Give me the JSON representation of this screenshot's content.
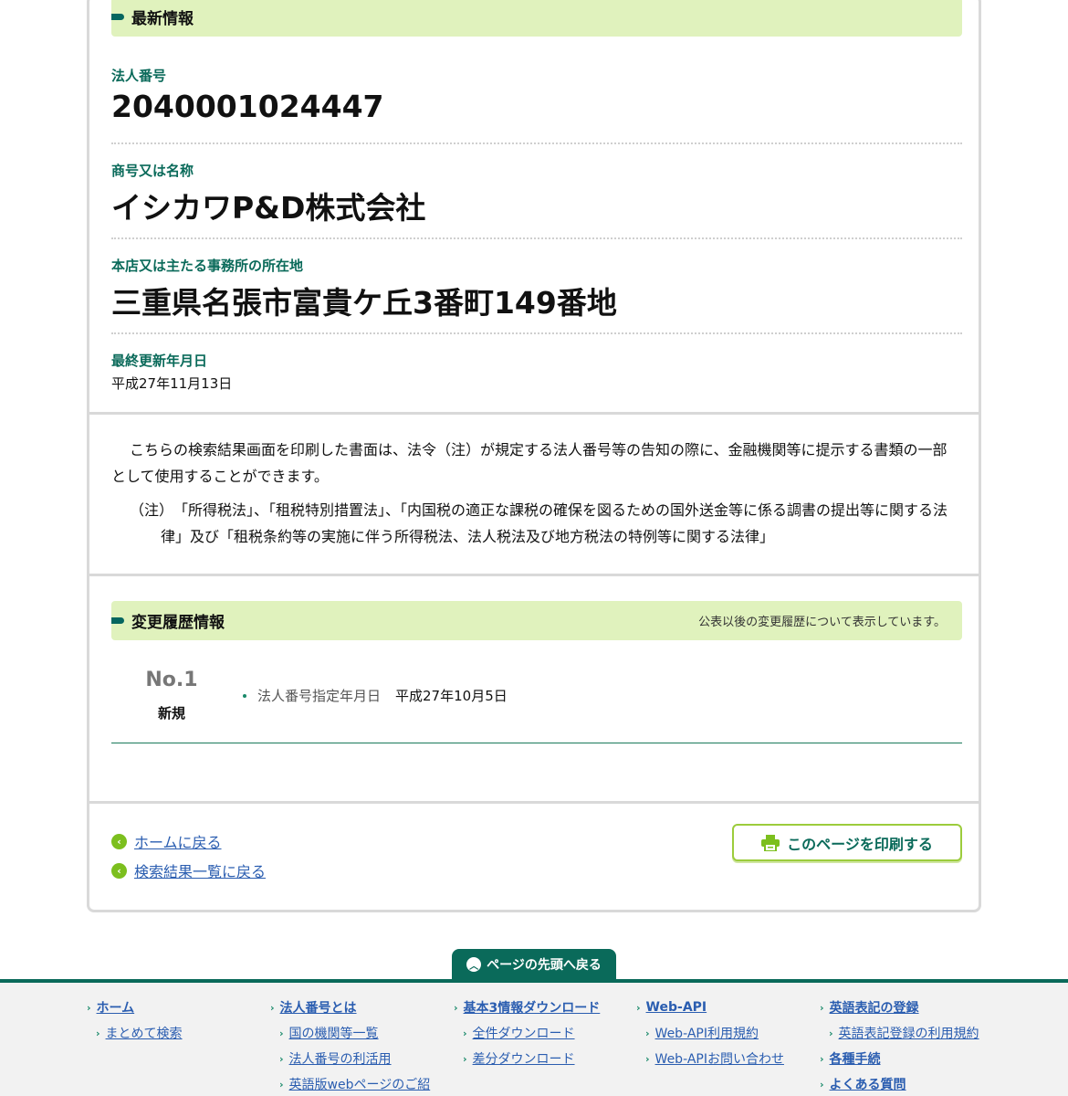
{
  "latest": {
    "heading": "最新情報",
    "corp_number_label": "法人番号",
    "corp_number": "2040001024447",
    "name_label": "商号又は名称",
    "name": "イシカワP&D株式会社",
    "address_label": "本店又は主たる事務所の所在地",
    "address": "三重県名張市富貴ケ丘3番町149番地",
    "updated_label": "最終更新年月日",
    "updated": "平成27年11月13日"
  },
  "notice": {
    "p1": "こちらの検索結果画面を印刷した書面は、法令（注）が規定する法人番号等の告知の際に、金融機関等に提示する書類の一部として使用することができます。",
    "p2": "（注）　「所得税法」、「租税特別措置法」、「内国税の適正な課税の確保を図るための国外送金等に係る調書の提出等に関する法律」及び「租税条約等の実施に伴う所得税法、法人税法及び地方税法の特例等に関する法律」"
  },
  "history": {
    "heading": "変更履歴情報",
    "note": "公表以後の変更履歴について表示しています。",
    "entries": [
      {
        "no": "No.1",
        "type": "新規",
        "item_key": "法人番号指定年月日",
        "item_value": "平成27年10月5日"
      }
    ]
  },
  "nav": {
    "home_link": "ホームに戻る",
    "results_link": "検索結果一覧に戻る",
    "print_button": "このページを印刷する",
    "to_top": "ページの先頭へ戻る"
  },
  "footer": {
    "col1": {
      "main": "ホーム",
      "subs": [
        "まとめて検索"
      ]
    },
    "col2": {
      "main": "法人番号とは",
      "subs": [
        "国の機関等一覧",
        "法人番号の利活用",
        "英語版webページのご紹"
      ]
    },
    "col3": {
      "main": "基本3情報ダウンロード",
      "subs": [
        "全件ダウンロード",
        "差分ダウンロード"
      ]
    },
    "col4": {
      "main": "Web-API",
      "subs": [
        "Web-API利用規約",
        "Web-APIお問い合わせ"
      ]
    },
    "col5": {
      "main": "英語表記の登録",
      "subs": [
        "英語表記登録の利用規約"
      ],
      "main2": "各種手続",
      "main3": "よくある質問"
    }
  },
  "colors": {
    "accent": "#0a6a5a",
    "head_bg": "#e0f2bd",
    "link": "#2a5db0",
    "button_border": "#9ccc3c"
  }
}
